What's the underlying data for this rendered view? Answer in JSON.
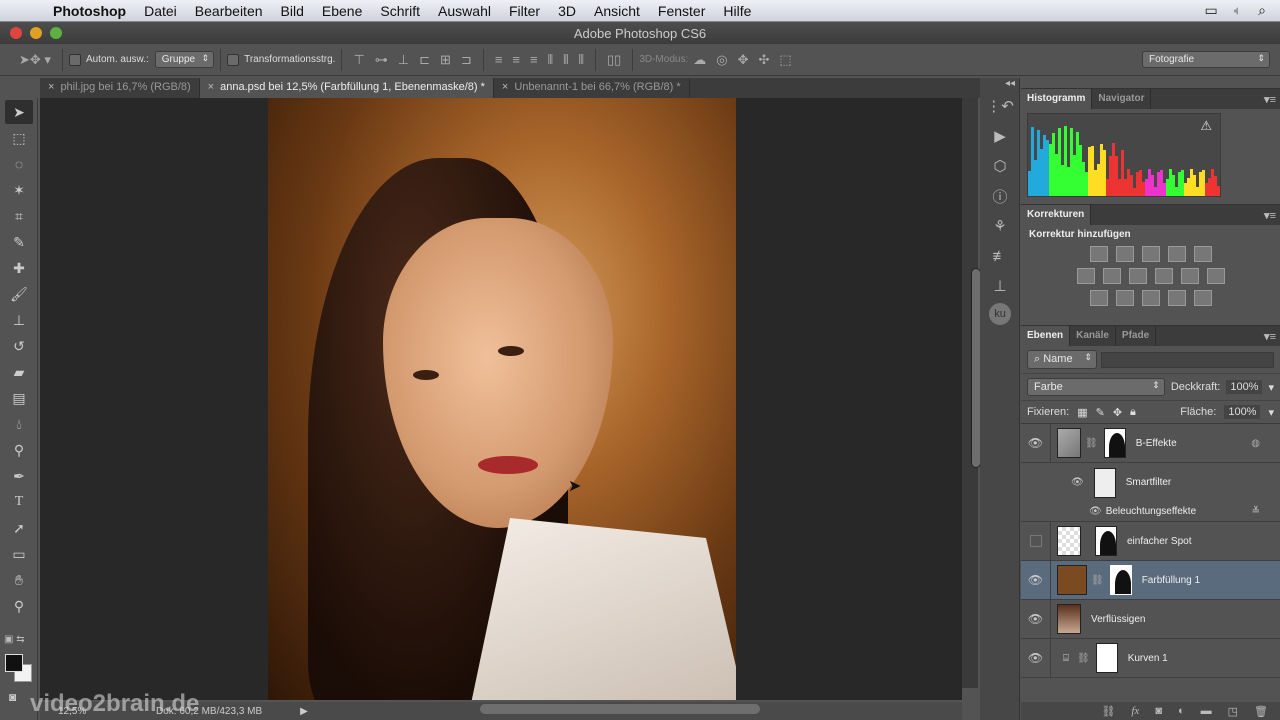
{
  "menubar": {
    "apple_icon": "",
    "items": [
      "Photoshop",
      "Datei",
      "Bearbeiten",
      "Bild",
      "Ebene",
      "Schrift",
      "Auswahl",
      "Filter",
      "3D",
      "Ansicht",
      "Fenster",
      "Hilfe"
    ],
    "status_icons": [
      "display-icon",
      "volume-icon",
      "spotlight-search-icon"
    ]
  },
  "window": {
    "title": "Adobe Photoshop CS6"
  },
  "options_bar": {
    "auto_select_label": "Autom. ausw.:",
    "auto_select_value": "Gruppe",
    "transform_label": "Transformationsstrg.",
    "mode3d_label": "3D-Modus:",
    "workspace_value": "Fotografie"
  },
  "doc_tabs": [
    {
      "label": "phil.jpg bei 16,7% (RGB/8)",
      "active": false
    },
    {
      "label": "anna.psd bei 12,5% (Farbfüllung 1, Ebenenmaske/8) *",
      "active": true
    },
    {
      "label": "Unbenannt-1 bei 66,7% (RGB/8) *",
      "active": false
    }
  ],
  "tools": [
    "move",
    "marquee",
    "lasso",
    "magic-wand",
    "crop",
    "eyedropper",
    "healing-brush",
    "brush",
    "clone-stamp",
    "history-brush",
    "eraser",
    "gradient",
    "blur",
    "dodge",
    "pen",
    "type",
    "path-selection",
    "rectangle",
    "hand",
    "zoom"
  ],
  "status_bar": {
    "zoom": "12,5%",
    "doc_size": "Dok: 60,2 MB/423,3 MB"
  },
  "watermark": "video2brain.de",
  "panels": {
    "histogram": {
      "tabs": [
        "Histogramm",
        "Navigator"
      ],
      "warning": "⚠"
    },
    "adjustments": {
      "tab": "Korrekturen",
      "heading": "Korrektur hinzufügen"
    },
    "layers": {
      "tabs": [
        "Ebenen",
        "Kanäle",
        "Pfade"
      ],
      "filter_kind": "Name",
      "blend_mode": "Farbe",
      "opacity_label": "Deckkraft:",
      "opacity_value": "100%",
      "lock_label": "Fixieren:",
      "fill_label": "Fläche:",
      "fill_value": "100%",
      "items": [
        {
          "name": "B-Effekte",
          "visible": true
        },
        {
          "name": "Smartfilter",
          "visible": true
        },
        {
          "name": "Beleuchtungseffekte",
          "visible": true
        },
        {
          "name": "einfacher Spot",
          "visible": false
        },
        {
          "name": "Farbfüllung 1",
          "visible": true,
          "selected": true
        },
        {
          "name": "Verflüssigen",
          "visible": true
        },
        {
          "name": "Kurven 1",
          "visible": true
        }
      ]
    }
  }
}
